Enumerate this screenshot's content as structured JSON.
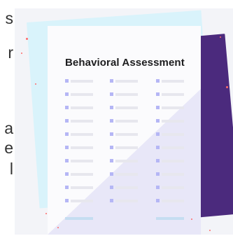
{
  "left_text_fragments": [
    "s",
    "r",
    "a",
    "e",
    "l"
  ],
  "document": {
    "title": "Behavioral Assessment"
  },
  "colors": {
    "cyan_panel": "#d9f3fb",
    "purple_panel": "#4b2a7d",
    "sheet": "#fbfbfd",
    "placeholder_bar": "#e7e7ee",
    "placeholder_dot": "#b5b6f5",
    "footer_line": "#c5ddf1",
    "sparkles": "#ff6a6a"
  }
}
